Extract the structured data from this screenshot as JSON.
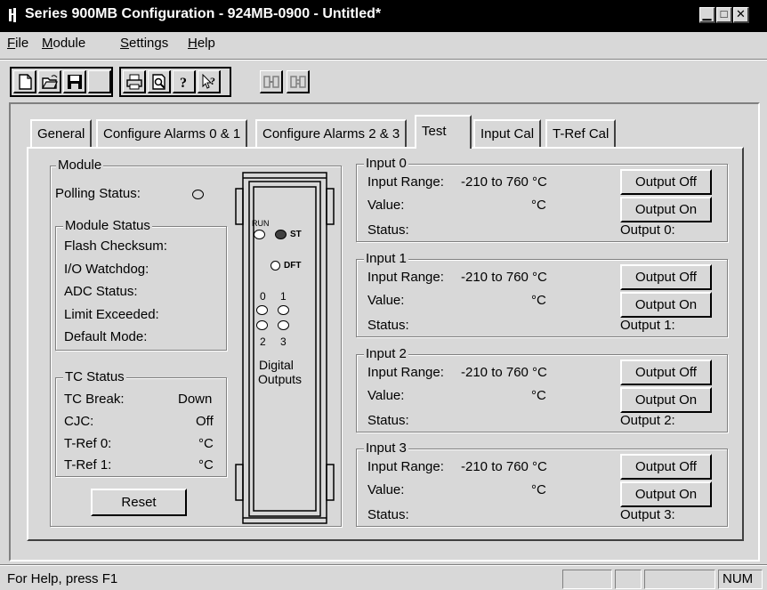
{
  "window": {
    "title": "Series 900MB Configuration - 924MB-0900 - Untitled*"
  },
  "menu": [
    {
      "label": "File",
      "key": "F"
    },
    {
      "label": "Module",
      "key": "M"
    },
    {
      "label": "Settings",
      "key": "S"
    },
    {
      "label": "Help",
      "key": "H"
    }
  ],
  "toolbar": {
    "icons": [
      "new-file-icon",
      "open-folder-icon",
      "save-disk-icon",
      "print-icon",
      "print-preview-icon",
      "about-question-icon",
      "context-help-icon",
      "get-config-icon",
      "send-config-icon"
    ]
  },
  "tabs": [
    "General",
    "Configure Alarms 0 & 1",
    "Configure Alarms 2 & 3",
    "Test",
    "Input Cal",
    "T-Ref Cal"
  ],
  "active_tab": "Test",
  "module": {
    "group_label": "Module",
    "polling_status_label": "Polling Status:",
    "module_status": {
      "group_label": "Module Status",
      "items": [
        "Flash Checksum:",
        "I/O Watchdog:",
        "ADC Status:",
        "Limit Exceeded:",
        "Default Mode:"
      ]
    },
    "tc_status": {
      "group_label": "TC Status",
      "rows": [
        {
          "label": "TC Break:",
          "value": "Down"
        },
        {
          "label": "CJC:",
          "value": "Off"
        },
        {
          "label": "T-Ref 0:",
          "value": "°C"
        },
        {
          "label": "T-Ref 1:",
          "value": "°C"
        }
      ]
    },
    "reset_label": "Reset"
  },
  "device": {
    "run_label": "RUN",
    "st_label": "ST",
    "dft_label": "DFT",
    "out_top_labels": [
      "0",
      "1"
    ],
    "out_bottom_labels": [
      "2",
      "3"
    ],
    "digital_label": "Digital",
    "outputs_label": "Outputs"
  },
  "inputs": [
    {
      "title": "Input 0",
      "range_label": "Input Range:",
      "range_value": "-210 to 760 °C",
      "value_label": "Value:",
      "unit": "°C",
      "status_label": "Status:",
      "output_off": "Output Off",
      "output_on": "Output On",
      "output_label": "Output 0:"
    },
    {
      "title": "Input 1",
      "range_label": "Input Range:",
      "range_value": "-210 to 760 °C",
      "value_label": "Value:",
      "unit": "°C",
      "status_label": "Status:",
      "output_off": "Output Off",
      "output_on": "Output On",
      "output_label": "Output 1:"
    },
    {
      "title": "Input 2",
      "range_label": "Input Range:",
      "range_value": "-210 to 760 °C",
      "value_label": "Value:",
      "unit": "°C",
      "status_label": "Status:",
      "output_off": "Output Off",
      "output_on": "Output On",
      "output_label": "Output 2:"
    },
    {
      "title": "Input 3",
      "range_label": "Input Range:",
      "range_value": "-210 to 760 °C",
      "value_label": "Value:",
      "unit": "°C",
      "status_label": "Status:",
      "output_off": "Output Off",
      "output_on": "Output On",
      "output_label": "Output 3:"
    }
  ],
  "statusbar": {
    "help_text": "For Help, press F1",
    "num_indicator": "NUM"
  }
}
